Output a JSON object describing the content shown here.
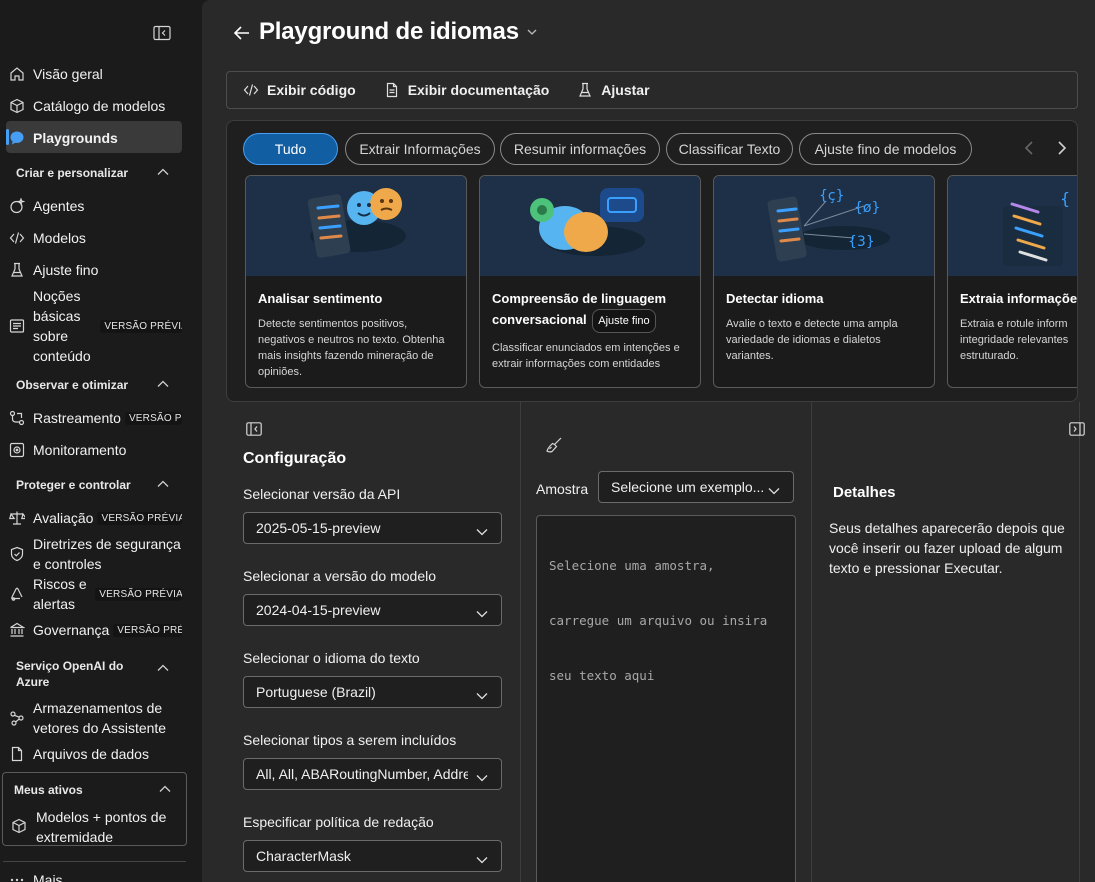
{
  "sidebar": {
    "collapse_icon": "panel-collapse-icon",
    "items": [
      {
        "label": "Visão geral",
        "icon": "home-icon"
      },
      {
        "label": "Catálogo de modelos",
        "icon": "cube-icon"
      },
      {
        "label": "Playgrounds",
        "icon": "chat-icon",
        "active": true
      }
    ],
    "sections": [
      {
        "title": "Criar e personalizar",
        "items": [
          {
            "label": "Agentes",
            "icon": "sparkle-icon"
          },
          {
            "label": "Modelos",
            "icon": "code-icon"
          },
          {
            "label": "Ajuste fino",
            "icon": "flask-icon"
          },
          {
            "label": "Noções básicas sobre conteúdo",
            "icon": "document-scan-icon",
            "badge": "VERSÃO PRÉVIA"
          }
        ]
      },
      {
        "title": "Observar e otimizar",
        "items": [
          {
            "label": "Rastreamento",
            "icon": "trace-icon",
            "badge": "VERSÃO PRÉ"
          },
          {
            "label": "Monitoramento",
            "icon": "monitor-icon"
          }
        ]
      },
      {
        "title": "Proteger e controlar",
        "items": [
          {
            "label": "Avaliação",
            "icon": "scale-icon",
            "badge": "VERSÃO PRÉVIA"
          },
          {
            "label": "Diretrizes de segurança e controles",
            "icon": "shield-icon"
          },
          {
            "label": "Riscos e alertas",
            "icon": "alert-icon",
            "badge": "VERSÃO PRÉVIA"
          },
          {
            "label": "Governança",
            "icon": "building-icon",
            "badge": "VERSÃO PRÉVI"
          }
        ]
      },
      {
        "title": "Serviço OpenAI do Azure",
        "items": [
          {
            "label": "Armazenamentos de vetores do Assistente",
            "icon": "vector-store-icon"
          },
          {
            "label": "Arquivos de dados",
            "icon": "file-icon"
          }
        ]
      }
    ],
    "my_assets": {
      "title": "Meus ativos",
      "items": [
        {
          "label": "Modelos + pontos de extremidade",
          "icon": "cube-icon"
        }
      ]
    },
    "more_label": "Mais"
  },
  "header": {
    "title": "Playground de idiomas"
  },
  "toolbar": {
    "view_code": "Exibir código",
    "view_docs": "Exibir documentação",
    "tune": "Ajustar"
  },
  "filters": [
    "Tudo",
    "Extrair Informações",
    "Resumir informações",
    "Classificar Texto",
    "Ajuste fino de modelos"
  ],
  "cards": [
    {
      "title": "Analisar sentimento",
      "desc": "Detecte sentimentos positivos, negativos e neutros no texto. Obtenha mais insights fazendo mineração de opiniões."
    },
    {
      "title": "Compreensão de linguagem conversacional",
      "tag": "Ajuste fino",
      "desc": "Classificar enunciados em intenções e extrair informações com entidades"
    },
    {
      "title": "Detectar idioma",
      "desc": "Avalie o texto e detecte uma ampla variedade de idiomas e dialetos variantes."
    },
    {
      "title": "Extraia informaçõe",
      "desc": "Extraia e rotule inform integridade relevantes estruturado."
    }
  ],
  "config": {
    "title": "Configuração",
    "api_version_label": "Selecionar versão da API",
    "api_version_value": "2025-05-15-preview",
    "model_version_label": "Selecionar a versão do modelo",
    "model_version_value": "2024-04-15-preview",
    "language_label": "Selecionar o idioma do texto",
    "language_value": "Portuguese (Brazil)",
    "types_label": "Selecionar tipos a serem incluídos",
    "types_value": "All, All, ABARoutingNumber, Address",
    "redaction_label": "Especificar política de redação",
    "redaction_value": "CharacterMask"
  },
  "sample": {
    "label": "Amostra",
    "select_placeholder": "Selecione um exemplo...",
    "text_lines": [
      "Selecione uma amostra,",
      "carregue um arquivo ou insira",
      "seu texto aqui"
    ]
  },
  "details": {
    "title": "Detalhes",
    "text": "Seus detalhes aparecerão depois que você inserir ou fazer upload de algum texto e pressionar Executar."
  },
  "colors": {
    "accent": "#479ef5",
    "pill_selected": "#115ea3",
    "background": "#292929"
  }
}
